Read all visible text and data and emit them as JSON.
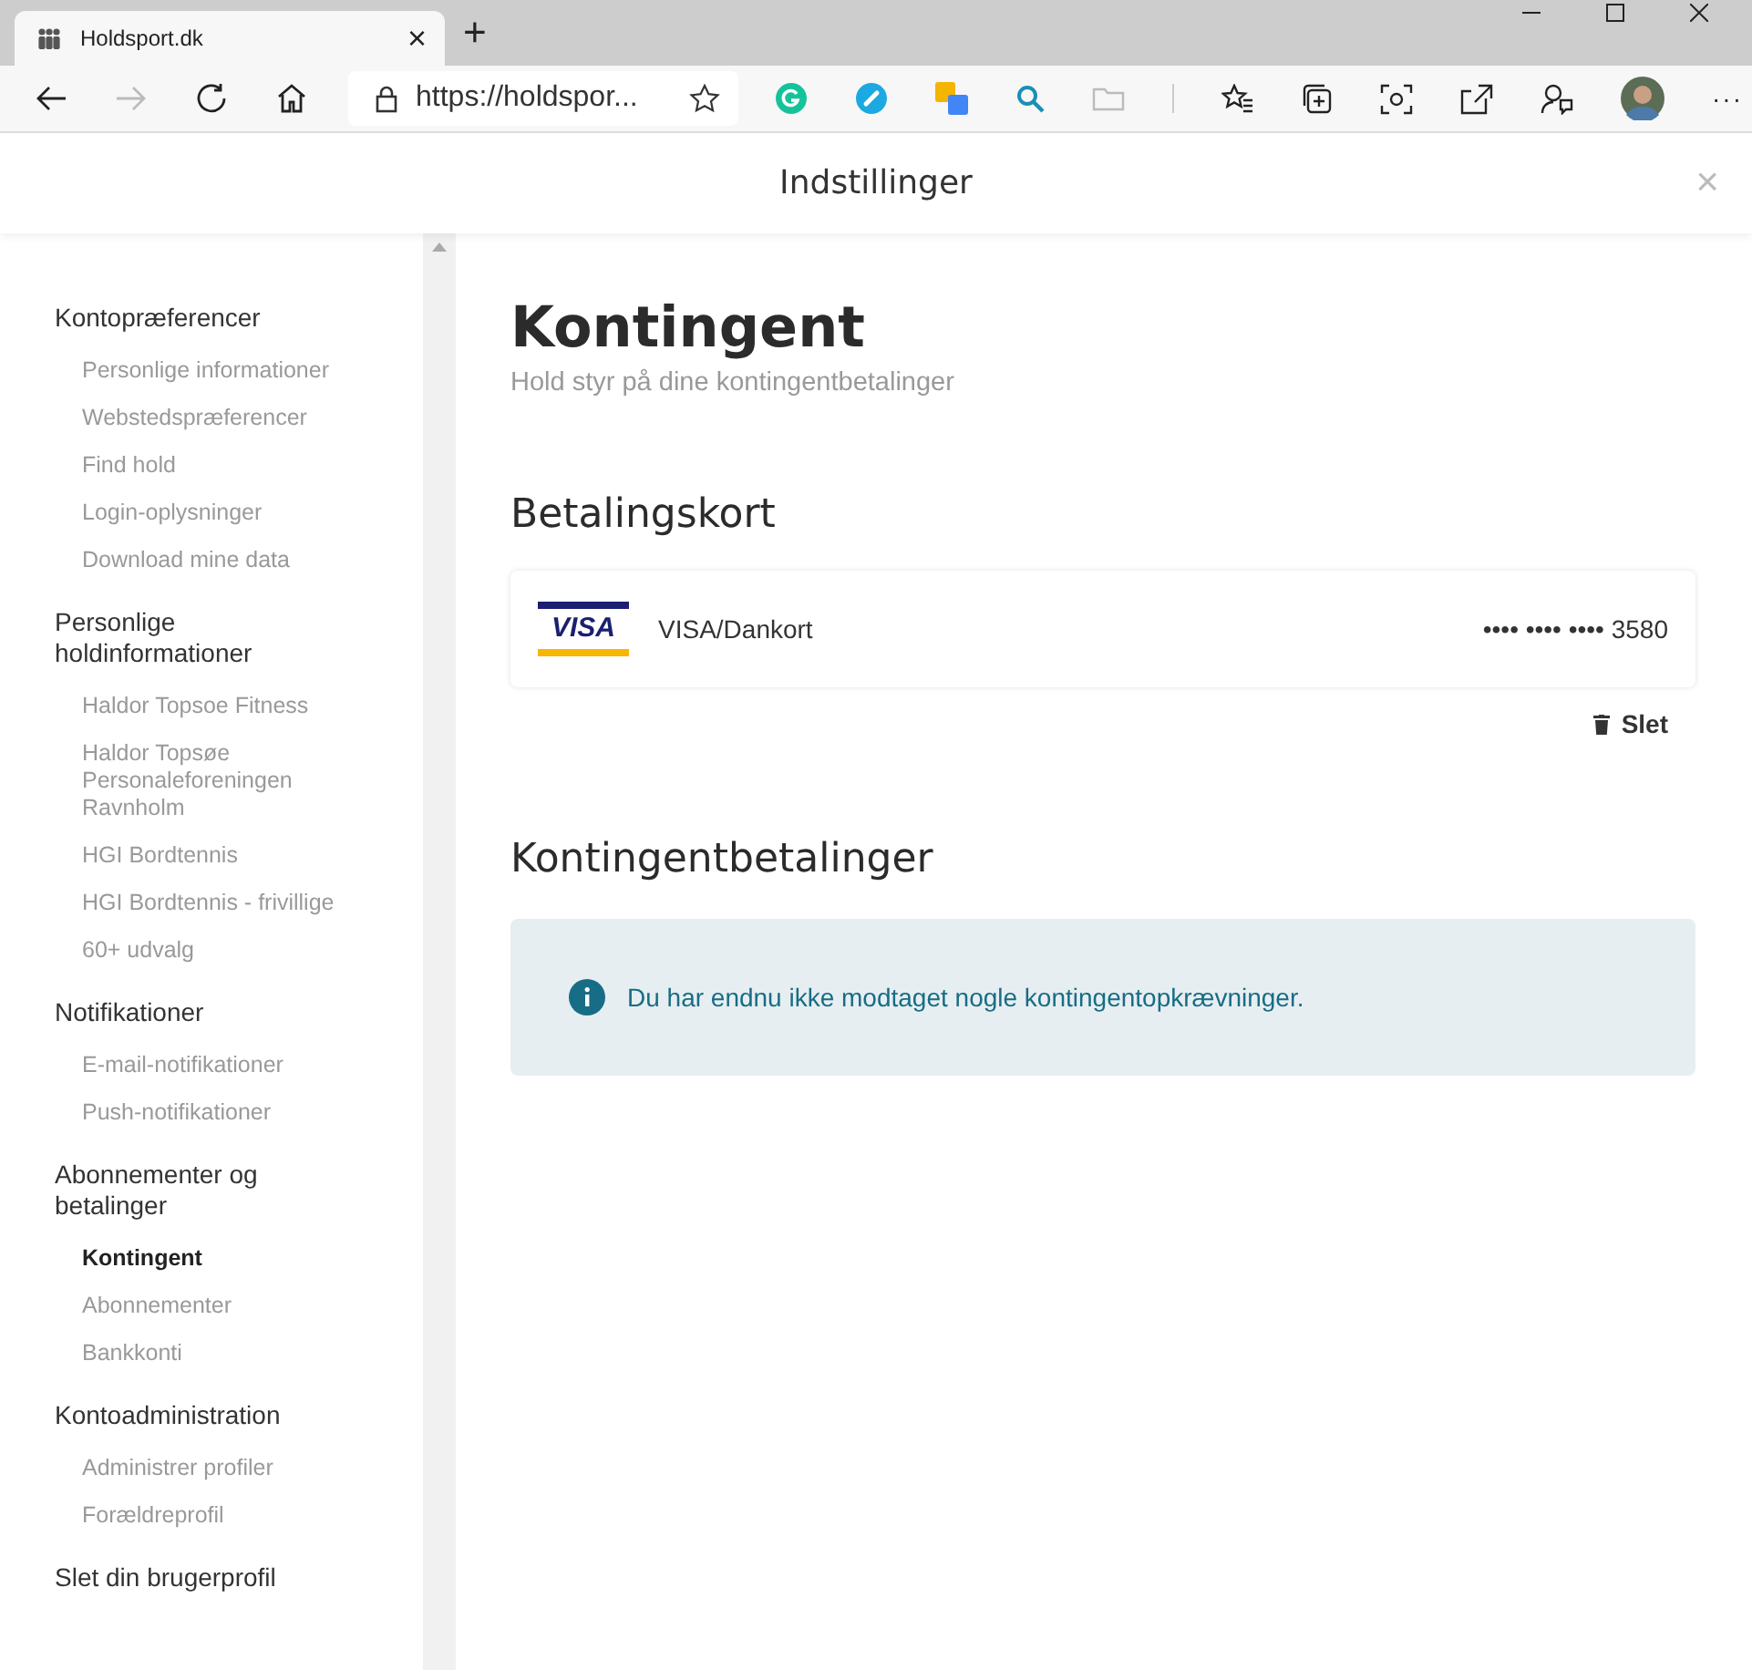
{
  "browser": {
    "tab": {
      "title": "Holdsport.dk",
      "close": "×"
    },
    "new_tab": "+",
    "address": "https://holdspor...",
    "more": "···"
  },
  "header": {
    "title": "Indstillinger",
    "close": "×"
  },
  "sidebar": [
    {
      "title": "Kontopræferencer",
      "items": [
        {
          "label": "Personlige informationer",
          "selected": false
        },
        {
          "label": "Webstedspræferencer",
          "selected": false
        },
        {
          "label": "Find hold",
          "selected": false
        },
        {
          "label": "Login-oplysninger",
          "selected": false
        },
        {
          "label": "Download mine data",
          "selected": false
        }
      ]
    },
    {
      "title": "Personlige holdinformationer",
      "items": [
        {
          "label": "Haldor Topsoe Fitness",
          "selected": false
        },
        {
          "label": "Haldor Topsøe Personaleforeningen Ravnholm",
          "selected": false
        },
        {
          "label": "HGI Bordtennis",
          "selected": false
        },
        {
          "label": "HGI Bordtennis - frivillige",
          "selected": false
        },
        {
          "label": "60+ udvalg",
          "selected": false
        }
      ]
    },
    {
      "title": "Notifikationer",
      "items": [
        {
          "label": "E-mail-notifikationer",
          "selected": false
        },
        {
          "label": "Push-notifikationer",
          "selected": false
        }
      ]
    },
    {
      "title": "Abonnementer og betalinger",
      "items": [
        {
          "label": "Kontingent",
          "selected": true
        },
        {
          "label": "Abonnementer",
          "selected": false
        },
        {
          "label": "Bankkonti",
          "selected": false
        }
      ]
    },
    {
      "title": "Kontoadministration",
      "items": [
        {
          "label": "Administrer profiler",
          "selected": false
        },
        {
          "label": "Forældreprofil",
          "selected": false
        }
      ]
    },
    {
      "title": "Slet din brugerprofil"
    }
  ],
  "page": {
    "title": "Kontingent",
    "subtitle": "Hold styr på dine kontingentbetalinger"
  },
  "cards_section": {
    "title": "Betalingskort",
    "card": {
      "logo": "VISA",
      "name": "VISA/Dankort",
      "number": "•••• •••• •••• 3580"
    },
    "delete": "Slet"
  },
  "payments_section": {
    "title": "Kontingentbetalinger",
    "notice": "Du har endnu ikke modtaget nogle kontingentopkrævninger."
  }
}
